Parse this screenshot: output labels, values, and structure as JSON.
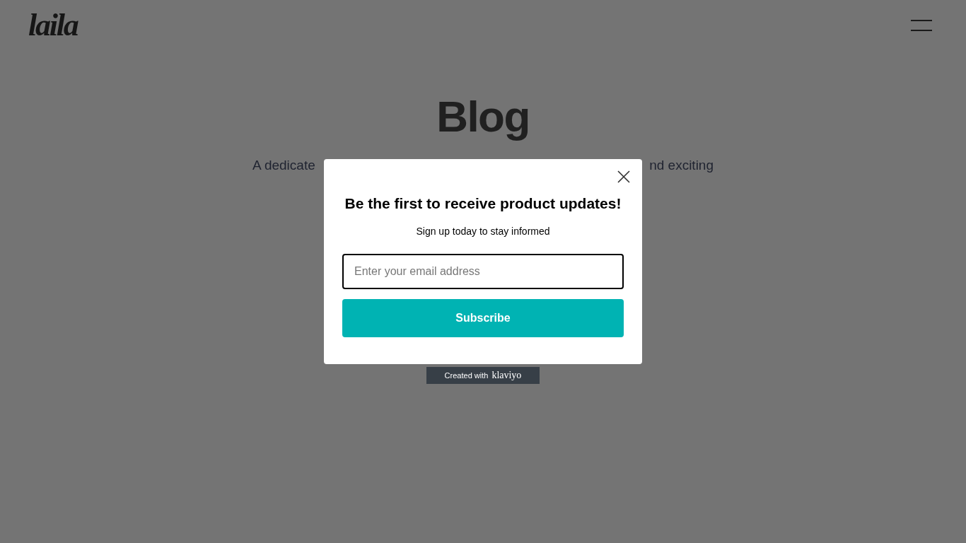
{
  "header": {
    "logo": "laila"
  },
  "page": {
    "title": "Blog",
    "subtitle_left": "A dedicate",
    "subtitle_right": "nd exciting"
  },
  "popup": {
    "heading": "Be the first to receive product updates!",
    "subheading": "Sign up today to stay informed",
    "email": {
      "placeholder": "Enter your email address"
    },
    "button": "Subscribe",
    "badge": {
      "prefix": "Created with",
      "brand": "klaviyo"
    }
  }
}
